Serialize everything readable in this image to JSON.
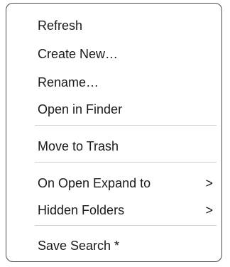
{
  "menu": {
    "items": [
      {
        "label": "Refresh"
      },
      {
        "label": "Create New…"
      },
      {
        "label": "Rename…"
      },
      {
        "label": "Open in Finder"
      },
      {
        "label": "Move to Trash"
      },
      {
        "label": "On Open Expand to",
        "submenu_icon": ">"
      },
      {
        "label": "Hidden Folders",
        "submenu_icon": ">"
      },
      {
        "label": "Save Search *"
      }
    ]
  },
  "colors": {
    "text": "#1a1a1a",
    "border": "#4a4a4a",
    "separator": "#d4d4d4",
    "background": "#ffffff"
  }
}
